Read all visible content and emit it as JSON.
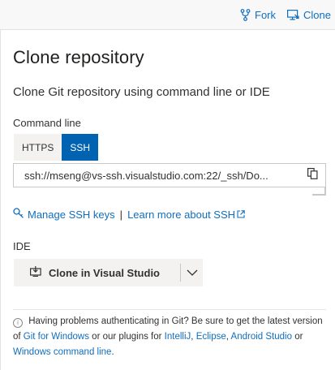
{
  "topbar": {
    "fork_label": "Fork",
    "clone_label": "Clone"
  },
  "panel": {
    "title": "Clone repository",
    "subtitle": "Clone Git repository using command line or IDE",
    "command_line": {
      "label": "Command line",
      "tabs": [
        {
          "label": "HTTPS",
          "active": false
        },
        {
          "label": "SSH",
          "active": true
        }
      ],
      "url": "ssh://mseng@vs-ssh.visualstudio.com:22/_ssh/Do..."
    },
    "links": {
      "manage_ssh": "Manage SSH keys",
      "separator": "|",
      "learn_more": "Learn more about SSH"
    },
    "ide": {
      "label": "IDE",
      "button_label": "Clone in Visual Studio"
    },
    "help": {
      "info_glyph": "i",
      "text_1": "Having problems authenticating in Git? Be sure to get the latest version of",
      "git_for_windows": "Git for Windows",
      "text_2": "or our plugins for",
      "intellij": "IntelliJ",
      "comma_1": ",",
      "eclipse": "Eclipse",
      "comma_2": ",",
      "android_studio": "Android Studio",
      "text_3": "or",
      "windows_cmd": "Windows command line",
      "period": "."
    }
  },
  "colors": {
    "accent": "#0063b1",
    "link": "#106ebe",
    "topbar_bg": "#f8f8f8",
    "button_bg": "#f3f2f1"
  },
  "icons": {
    "fork": "fork-icon",
    "clone": "clone-icon",
    "copy": "copy-icon",
    "key": "key-icon",
    "external_link": "external-link-icon",
    "visual_studio": "clone-to-ide-icon",
    "chevron": "chevron-down-icon",
    "info": "info-icon"
  }
}
